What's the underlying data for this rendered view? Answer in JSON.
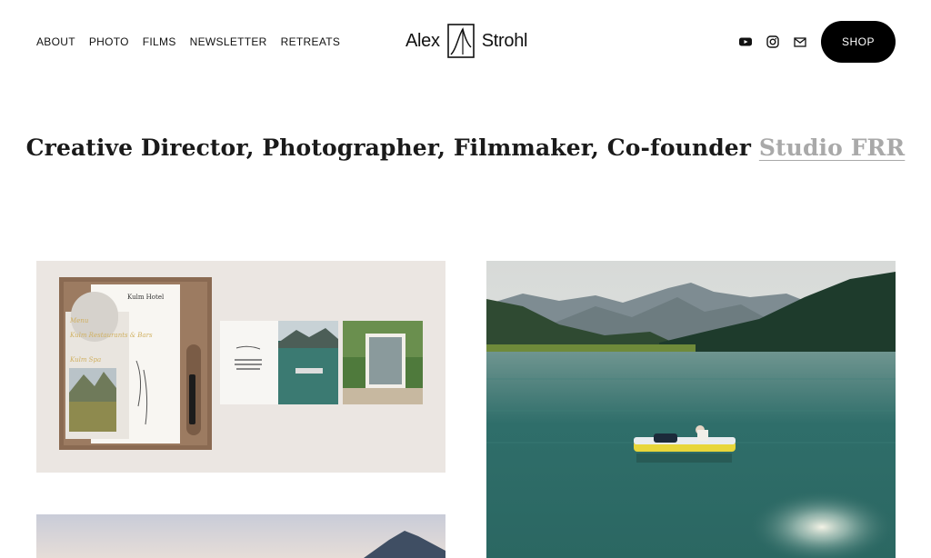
{
  "nav": {
    "items": [
      {
        "label": "ABOUT"
      },
      {
        "label": "PHOTO"
      },
      {
        "label": "FILMS"
      },
      {
        "label": "NEWSLETTER"
      },
      {
        "label": "RETREATS"
      }
    ]
  },
  "logo": {
    "first": "Alex",
    "last": "Strohl"
  },
  "social": {
    "icons": [
      "youtube-icon",
      "instagram-icon",
      "mail-icon"
    ]
  },
  "shop": {
    "label": "SHOP"
  },
  "tagline": {
    "text": "Creative Director, Photographer, Filmmaker, Co-founder",
    "link": "Studio FRR"
  },
  "tiles": {
    "menu_card": {
      "title": "Kulm Hotel",
      "line1": "Menu",
      "line2": "Kulm Restaurants & Bars",
      "line3": "Kulm Spa"
    }
  },
  "colors": {
    "accent": "#000000",
    "link": "#a9a9a9",
    "tile_bg": "#ebe6e2"
  }
}
